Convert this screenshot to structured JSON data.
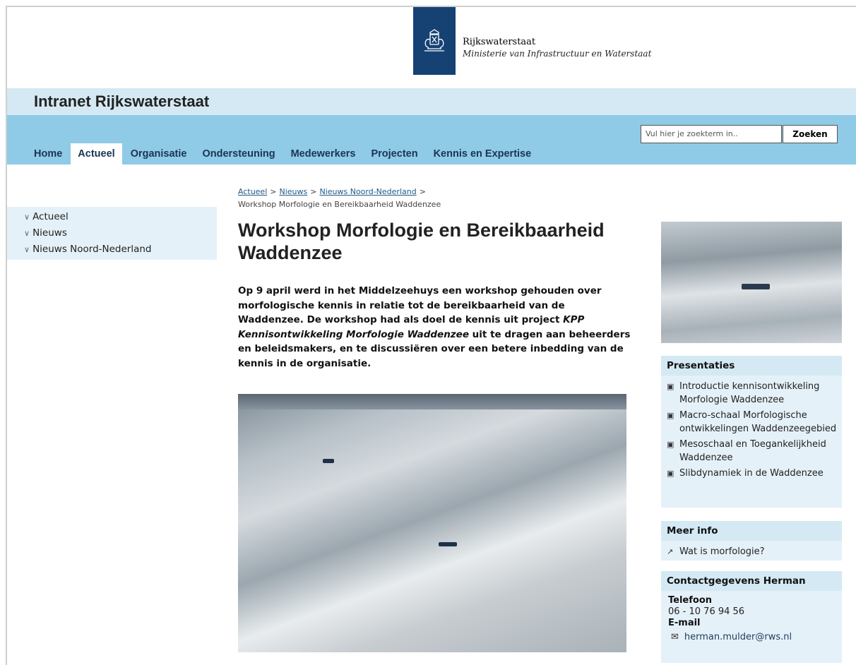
{
  "header": {
    "org_name": "Rijkswaterstaat",
    "ministry": "Ministerie van Infrastructuur en Waterstaat",
    "logo_icon": "royal-crest-icon"
  },
  "site_title": "Intranet Rijkswaterstaat",
  "nav": {
    "items": [
      {
        "label": "Home",
        "active": false
      },
      {
        "label": "Actueel",
        "active": true
      },
      {
        "label": "Organisatie",
        "active": false
      },
      {
        "label": "Ondersteuning",
        "active": false
      },
      {
        "label": "Medewerkers",
        "active": false
      },
      {
        "label": "Projecten",
        "active": false
      },
      {
        "label": "Kennis en Expertise",
        "active": false
      }
    ],
    "search_placeholder": "Vul hier je zoekterm in..",
    "search_button": "Zoeken"
  },
  "left_nav": {
    "items": [
      {
        "label": "Actueel"
      },
      {
        "label": "Nieuws"
      },
      {
        "label": "Nieuws Noord-Nederland"
      }
    ]
  },
  "breadcrumb": {
    "links": [
      "Actueel",
      "Nieuws",
      "Nieuws Noord-Nederland"
    ],
    "current": "Workshop Morfologie en Bereikbaarheid Waddenzee"
  },
  "article": {
    "title": "Workshop Morfologie en Bereikbaarheid Waddenzee",
    "intro_part1": "Op 9 april werd in het Middelzeehuys een workshop gehouden over morfologische kennis in relatie tot de bereikbaarheid van de Waddenzee. De workshop had als doel de kennis uit project ",
    "intro_italic": "KPP Kennisontwikkeling Morfologie Waddenzee",
    "intro_part2": " uit te dragen aan beheerders en beleidsmakers, en te discussiëren over een betere inbedding van de kennis in de organisatie."
  },
  "presentaties": {
    "title": "Presentaties",
    "items": [
      "Introductie kennisontwikkeling Morfologie Waddenzee",
      "Macro-schaal Morfologische ontwikkelingen Waddenzeegebied",
      "Mesoschaal en Toegankelijkheid Waddenzee",
      "Slibdynamiek in de Waddenzee"
    ]
  },
  "meer_info": {
    "title": "Meer info",
    "items": [
      "Wat is morfologie?"
    ]
  },
  "contact": {
    "title": "Contactgegevens Herman",
    "phone_label": "Telefoon",
    "phone": "06 - 10 76 94 56",
    "email_label": "E-mail",
    "email": "herman.mulder@rws.nl"
  },
  "colors": {
    "brand_blue": "#154273",
    "nav_bg": "#8fcae7",
    "title_bar_bg": "#d4e9f3",
    "sidebar_bg": "#e5f1f8"
  }
}
